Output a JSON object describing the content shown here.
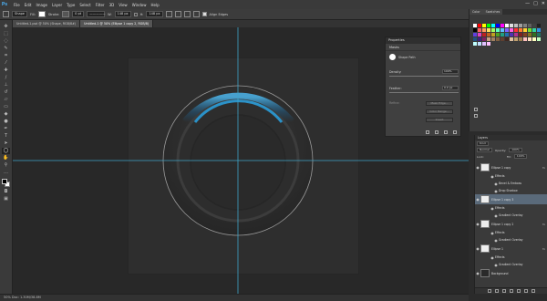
{
  "app": {
    "logo": "Ps",
    "menus": [
      "File",
      "Edit",
      "Image",
      "Layer",
      "Type",
      "Select",
      "Filter",
      "3D",
      "View",
      "Window",
      "Help"
    ],
    "window_controls": [
      "—",
      "□",
      "✕"
    ]
  },
  "options_bar": {
    "mode": "Shape",
    "fill_label": "Fill:",
    "stroke_label": "Stroke:",
    "stroke_width": "0 pt",
    "w_label": "W:",
    "w_value": "148 px",
    "h_label": "H:",
    "h_value": "148 px",
    "align_edges_label": "Align Edges"
  },
  "doc_tabs": [
    "Untitled-1.psd @ 50% (Shape, RGB/8#)",
    "Untitled-1 @ 50% (Ellipse 1 copy 2, RGB/8)"
  ],
  "status": {
    "zoom_doc": "50%   Doc: 1.30M/38.8M"
  },
  "canvas": {
    "guide_color": "#3fa4c9",
    "accent_blue": "#2a9cd8"
  },
  "swatches": {
    "tab_color": "Color",
    "tab_swatches": "Swatches",
    "colors": [
      "#ffffff",
      "#ff0000",
      "#ffff00",
      "#00ff00",
      "#00ffff",
      "#0000ff",
      "#ff00ff",
      "#ffffff",
      "#e0e0e0",
      "#c0c0c0",
      "#a0a0a0",
      "#808080",
      "#606060",
      "#404040",
      "#202020",
      "#000000",
      "#ff6060",
      "#ff9a60",
      "#ffe060",
      "#a0ff60",
      "#60ffc0",
      "#60c0ff",
      "#8060ff",
      "#ff60e0",
      "#ff3030",
      "#ff7a30",
      "#ffd030",
      "#70e030",
      "#30d0a0",
      "#3090e0",
      "#6040e0",
      "#e040c0",
      "#c02020",
      "#c06020",
      "#c0a020",
      "#50a020",
      "#20a080",
      "#2070b0",
      "#5030b0",
      "#b03090",
      "#802020",
      "#804020",
      "#807020",
      "#307020",
      "#207060",
      "#205080",
      "#402080",
      "#802060",
      "#c8a080",
      "#a08060",
      "#806040",
      "#604030",
      "#402820",
      "#e0c0a0",
      "#c0a070",
      "#a08050",
      "#ffc0c0",
      "#ffe0c0",
      "#ffffc0",
      "#c0ffc0",
      "#c0ffff",
      "#c0e0ff",
      "#e0c0ff",
      "#ffc0ff"
    ]
  },
  "properties": {
    "tab": "Properties",
    "subtitle": "Masks",
    "shape_path": "Shape Path",
    "density_label": "Density:",
    "density_value": "100%",
    "feather_label": "Feather:",
    "feather_value": "0.0 px",
    "refine_label": "Refine:",
    "btn_mask_edge": "Mask Edge...",
    "btn_color_range": "Color Range...",
    "btn_invert": "Invert"
  },
  "layers": {
    "tab": "Layers",
    "kind": "Kind",
    "blend": "Normal",
    "opacity_label": "Opacity:",
    "opacity_value": "100%",
    "lock_label": "Lock:",
    "fill_label": "Fill:",
    "fill_value": "100%",
    "rows": [
      {
        "name": "Ellipse 1 copy",
        "type": "layer",
        "fx": true
      },
      {
        "name": "Effects",
        "type": "effects"
      },
      {
        "name": "Bevel & Emboss",
        "type": "effect"
      },
      {
        "name": "Drop Shadow",
        "type": "effect"
      },
      {
        "name": "Ellipse 1 copy 3",
        "type": "layer",
        "selected": true
      },
      {
        "name": "Effects",
        "type": "effects"
      },
      {
        "name": "Gradient Overlay",
        "type": "effect"
      },
      {
        "name": "Ellipse 1 copy 2",
        "type": "layer",
        "fx": true
      },
      {
        "name": "Effects",
        "type": "effects"
      },
      {
        "name": "Gradient Overlay",
        "type": "effect"
      },
      {
        "name": "Ellipse 1",
        "type": "layer",
        "fx": true
      },
      {
        "name": "Effects",
        "type": "effects"
      },
      {
        "name": "Gradient Overlay",
        "type": "effect"
      },
      {
        "name": "Background",
        "type": "background"
      }
    ]
  }
}
